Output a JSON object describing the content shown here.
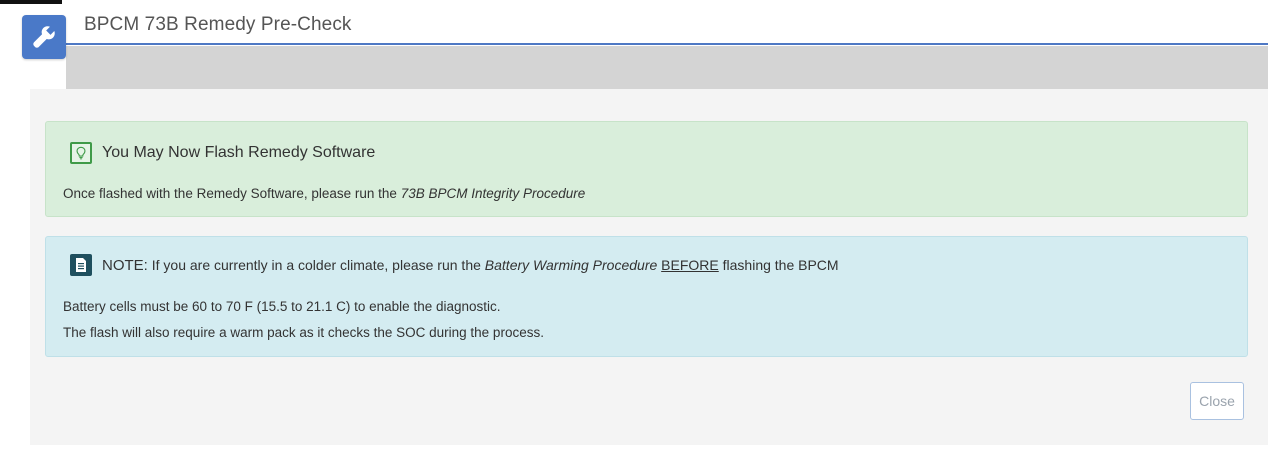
{
  "window": {
    "title": "BPCM 73B Remedy Pre-Check",
    "icon": "wrench-icon",
    "accent_color": "#4a79c8"
  },
  "success_alert": {
    "icon": "lightbulb-icon",
    "heading": "You May Now Flash Remedy Software",
    "text_prefix": "Once flashed with the Remedy Software, please run the ",
    "text_link": "73B BPCM Integrity Procedure",
    "color": "#d9eedb"
  },
  "info_alert": {
    "icon": "document-icon",
    "note_label": "NOTE:",
    "note_prefix": " If you are currently in a colder climate, please run the ",
    "note_procedure": "Battery Warming Procedure",
    "note_before": "BEFORE",
    "note_suffix": " flashing the BPCM",
    "line1": "Battery cells must be 60 to 70 F (15.5 to 21.1 C) to enable the diagnostic.",
    "line2": "The flash will also require a warm pack as it checks the SOC during the process.",
    "color": "#d4ecf1"
  },
  "footer": {
    "close_label": "Close"
  }
}
